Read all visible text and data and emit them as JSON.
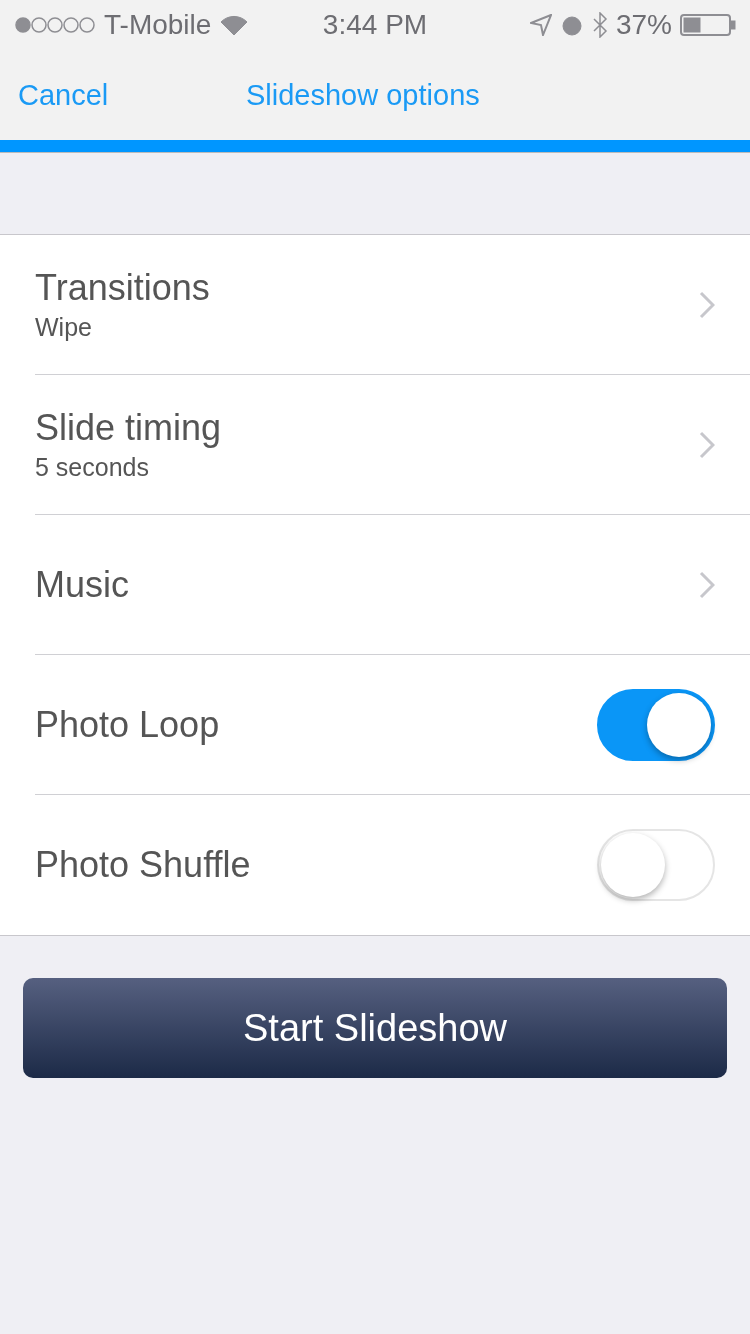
{
  "status_bar": {
    "carrier": "T-Mobile",
    "time": "3:44 PM",
    "battery": "37%"
  },
  "nav": {
    "cancel": "Cancel",
    "title": "Slideshow options"
  },
  "rows": [
    {
      "kind": "link",
      "label": "Transitions",
      "value": "Wipe"
    },
    {
      "kind": "link",
      "label": "Slide timing",
      "value": "5 seconds"
    },
    {
      "kind": "link",
      "label": "Music"
    },
    {
      "kind": "toggle",
      "label": "Photo Loop",
      "on": true
    },
    {
      "kind": "toggle",
      "label": "Photo Shuffle",
      "on": false
    }
  ],
  "start_button": "Start Slideshow"
}
